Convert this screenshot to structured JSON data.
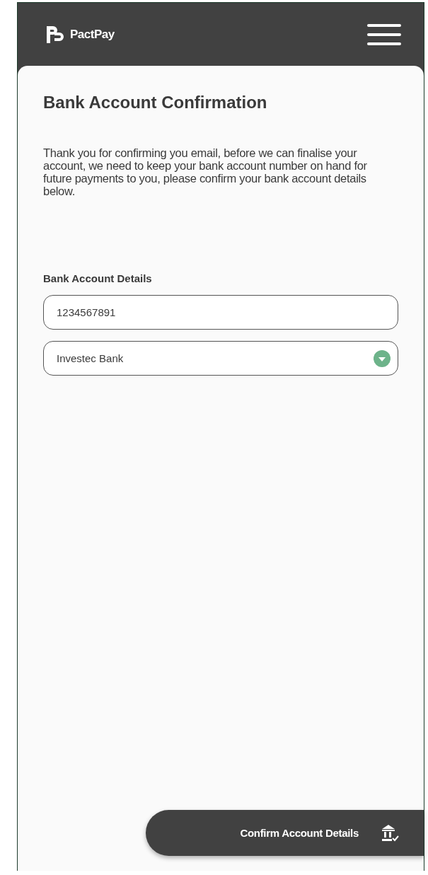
{
  "header": {
    "brand": "PactPay"
  },
  "page": {
    "title": "Bank Account Confirmation",
    "message": "Thank you for confirming you email, before we can finalise your account, we need to keep your bank account number on hand for future payments to you, please confirm your bank account details below."
  },
  "form": {
    "label": "Bank Account Details",
    "account_number": {
      "value": "1234567891"
    },
    "bank": {
      "value": "Investec Bank"
    }
  },
  "action": {
    "label": "Confirm Account Details"
  }
}
